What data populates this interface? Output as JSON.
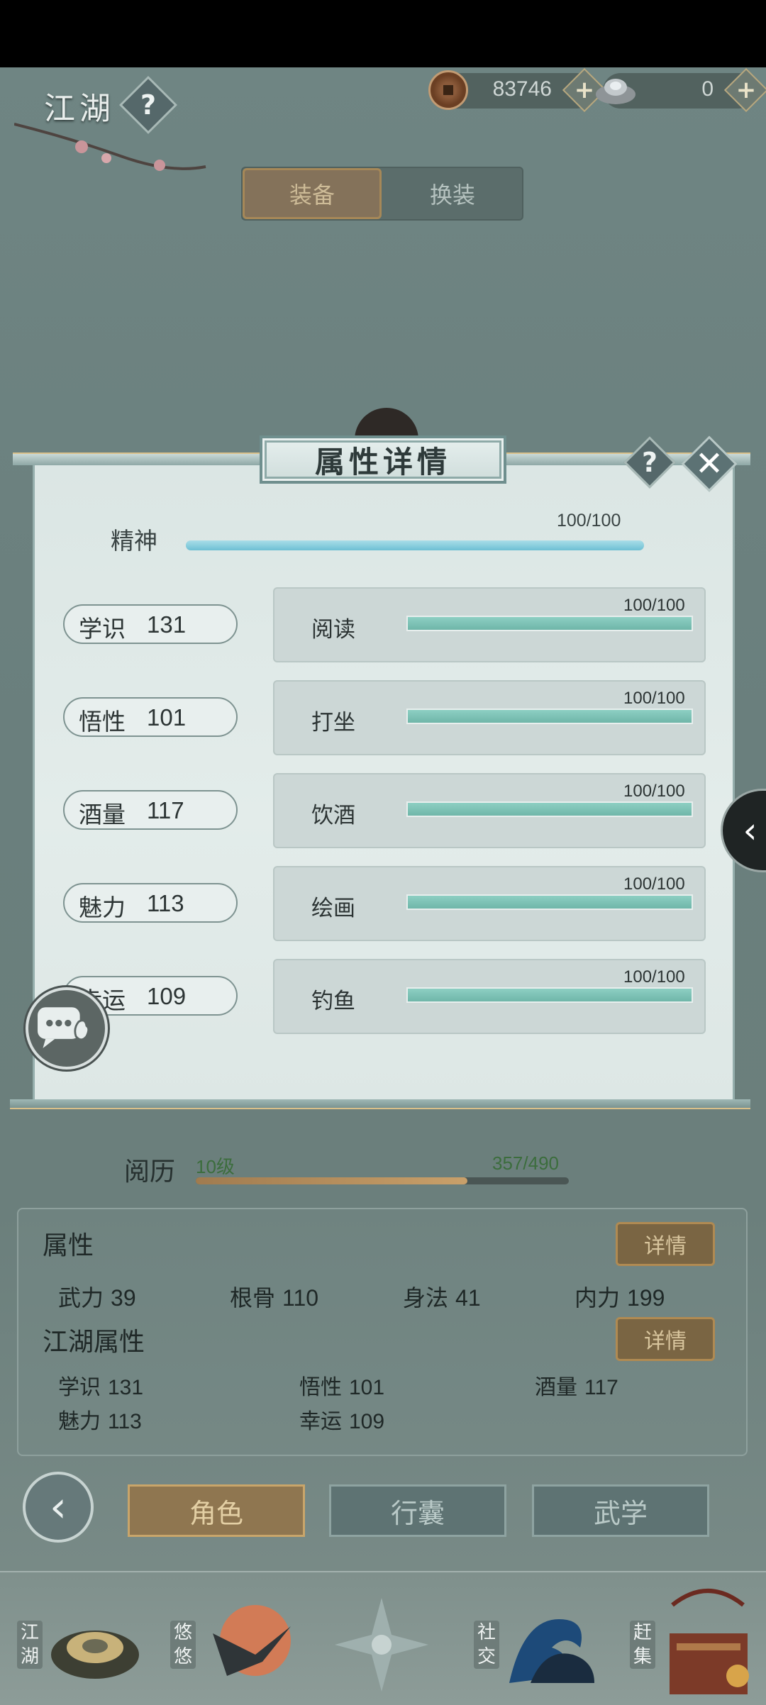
{
  "topbar": {
    "title": "江湖",
    "coins": "83746",
    "ingots": "0"
  },
  "equip_tabs": [
    "装备",
    "换装"
  ],
  "modal": {
    "title": "属性详情",
    "spirit": {
      "label": "精神",
      "value": "100/100",
      "fraction": 1.0
    },
    "attributes": [
      {
        "name": "学识",
        "value": "131",
        "skill": "阅读",
        "progress": "100/100",
        "fraction": 1.0
      },
      {
        "name": "悟性",
        "value": "101",
        "skill": "打坐",
        "progress": "100/100",
        "fraction": 1.0
      },
      {
        "name": "酒量",
        "value": "117",
        "skill": "饮酒",
        "progress": "100/100",
        "fraction": 1.0
      },
      {
        "name": "魅力",
        "value": "113",
        "skill": "绘画",
        "progress": "100/100",
        "fraction": 1.0
      },
      {
        "name": "幸运",
        "value": "109",
        "skill": "钓鱼",
        "progress": "100/100",
        "fraction": 1.0
      }
    ]
  },
  "experience": {
    "label": "阅历",
    "level": "10级",
    "value": "357/490",
    "fraction": 0.7286
  },
  "stats_panel": {
    "attr_title": "属性",
    "detail_label": "详情",
    "attrs": [
      {
        "name": "武力",
        "value": "39"
      },
      {
        "name": "根骨",
        "value": "110"
      },
      {
        "name": "身法",
        "value": "41"
      },
      {
        "name": "内力",
        "value": "199"
      }
    ],
    "jianghu_title": "江湖属性",
    "jianghu_attrs": [
      {
        "name": "学识",
        "value": "131"
      },
      {
        "name": "悟性",
        "value": "101"
      },
      {
        "name": "酒量",
        "value": "117"
      },
      {
        "name": "魅力",
        "value": "113"
      },
      {
        "name": "幸运",
        "value": "109"
      }
    ]
  },
  "nav_tabs": {
    "role": "角色",
    "bag": "行囊",
    "martial": "武学"
  },
  "dock": {
    "jianghu": "江湖",
    "youyou": "悠悠",
    "social": "社交",
    "market": "赶集"
  },
  "colors": {
    "accent_gold": "#8f7650",
    "teal_bar": "#6fb6a9",
    "spirit_bar": "#6ec0d4"
  }
}
